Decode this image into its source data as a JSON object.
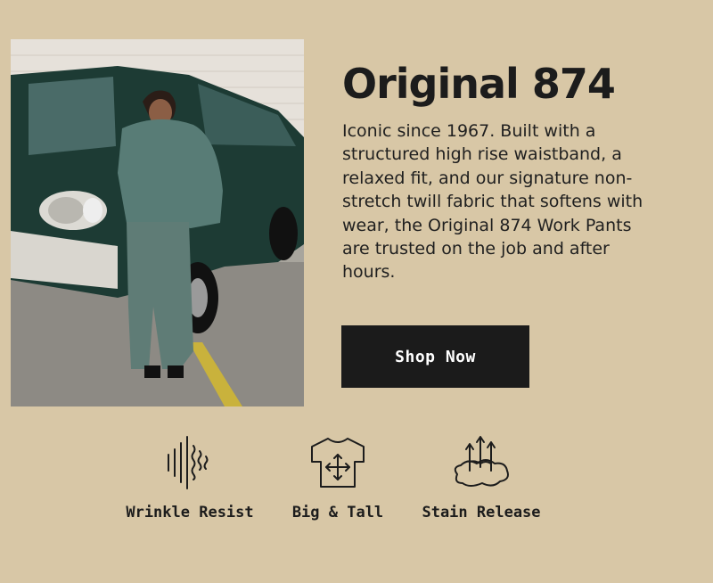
{
  "hero": {
    "image_alt": "Person in a green work jacket and matching work pants leaning against a dark green vintage van"
  },
  "product": {
    "title": "Original 874",
    "description": "Iconic since 1967. Built with a structured high rise waistband, a relaxed fit, and our signature non-stretch twill fabric that softens with wear, the Original 874 Work Pants are trusted on the job and after hours."
  },
  "cta": {
    "label": "Shop Now"
  },
  "features": [
    {
      "label": "Wrinkle Resist",
      "icon": "wrinkle-resist-icon"
    },
    {
      "label": "Big & Tall",
      "icon": "big-and-tall-icon"
    },
    {
      "label": "Stain Release",
      "icon": "stain-release-icon"
    }
  ],
  "colors": {
    "background": "#d8c7a6",
    "button": "#1b1b1b",
    "button_text": "#ffffff",
    "text": "#1c1c1c"
  }
}
